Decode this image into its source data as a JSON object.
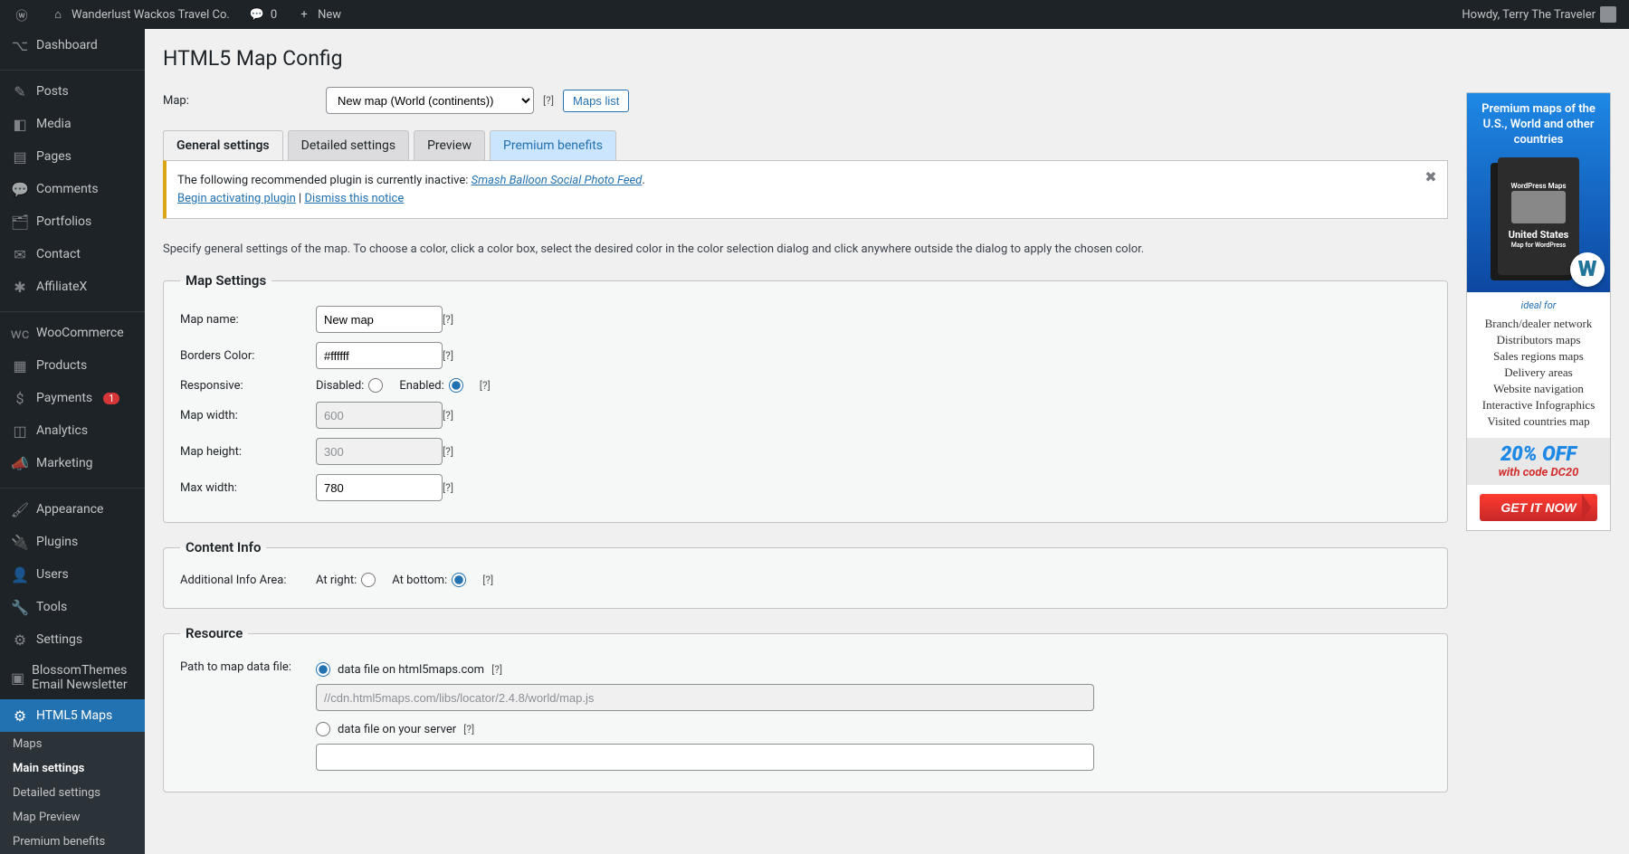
{
  "adminbar": {
    "site_name": "Wanderlust Wackos Travel Co.",
    "comments_count": "0",
    "new_label": "New",
    "howdy": "Howdy, Terry The Traveler"
  },
  "sidebar": {
    "items": [
      {
        "icon": "⌥",
        "label": "Dashboard"
      },
      {
        "icon": "✎",
        "label": "Posts"
      },
      {
        "icon": "◧",
        "label": "Media"
      },
      {
        "icon": "▤",
        "label": "Pages"
      },
      {
        "icon": "💬",
        "label": "Comments"
      },
      {
        "icon": "🗂",
        "label": "Portfolios"
      },
      {
        "icon": "✉",
        "label": "Contact"
      },
      {
        "icon": "✱",
        "label": "AffiliateX"
      },
      {
        "icon": "wc",
        "label": "WooCommerce"
      },
      {
        "icon": "▦",
        "label": "Products"
      },
      {
        "icon": "$",
        "label": "Payments",
        "badge": "1"
      },
      {
        "icon": "◫",
        "label": "Analytics"
      },
      {
        "icon": "📣",
        "label": "Marketing"
      },
      {
        "icon": "🖌",
        "label": "Appearance"
      },
      {
        "icon": "🔌",
        "label": "Plugins"
      },
      {
        "icon": "👤",
        "label": "Users"
      },
      {
        "icon": "🔧",
        "label": "Tools"
      },
      {
        "icon": "⚙",
        "label": "Settings"
      },
      {
        "icon": "▣",
        "label": "BlossomThemes Email Newsletter"
      },
      {
        "icon": "⚙",
        "label": "HTML5 Maps",
        "active": true
      }
    ],
    "submenu": [
      {
        "label": "Maps"
      },
      {
        "label": "Main settings",
        "current": true
      },
      {
        "label": "Detailed settings"
      },
      {
        "label": "Map Preview"
      },
      {
        "label": "Premium benefits"
      }
    ]
  },
  "page": {
    "title": "HTML5 Map Config",
    "map_label": "Map:",
    "map_select": "New map (World (continents))",
    "maps_list_btn": "Maps list",
    "help": "[?]"
  },
  "tabs": [
    "General settings",
    "Detailed settings",
    "Preview",
    "Premium benefits"
  ],
  "notice": {
    "text": "The following recommended plugin is currently inactive: ",
    "plugin": "Smash Balloon Social Photo Feed",
    "activate": "Begin activating plugin",
    "sep": " | ",
    "dismiss": "Dismiss this notice"
  },
  "desc": "Specify general settings of the map. To choose a color, click a color box, select the desired color in the color selection dialog and click anywhere outside the dialog to apply the chosen color.",
  "map_settings": {
    "legend": "Map Settings",
    "name_label": "Map name:",
    "name_value": "New map",
    "borders_label": "Borders Color:",
    "borders_value": "#ffffff",
    "responsive_label": "Responsive:",
    "disabled": "Disabled:",
    "enabled": "Enabled:",
    "width_label": "Map width:",
    "width_value": "600",
    "height_label": "Map height:",
    "height_value": "300",
    "max_label": "Max width:",
    "max_value": "780"
  },
  "content_info": {
    "legend": "Content Info",
    "area_label": "Additional Info Area:",
    "right": "At right:",
    "bottom": "At bottom:"
  },
  "resource": {
    "legend": "Resource",
    "path_label": "Path to map data file:",
    "opt1": "data file on html5maps.com",
    "url1": "//cdn.html5maps.com/libs/locator/2.4.8/world/map.js",
    "opt2": "data file on your server"
  },
  "promo": {
    "headline": "Premium maps of the U.S., World and other countries",
    "box_top": "WordPress Maps",
    "box_title": "United States",
    "box_sub": "Map for WordPress",
    "ideal": "ideal for",
    "uses": [
      "Branch/dealer network",
      "Distributors maps",
      "Sales regions maps",
      "Delivery areas",
      "Website navigation",
      "Interactive Infographics",
      "Visited countries map"
    ],
    "off_pct": "20% OFF",
    "off_code": "with code DC20",
    "cta": "GET IT NOW"
  }
}
